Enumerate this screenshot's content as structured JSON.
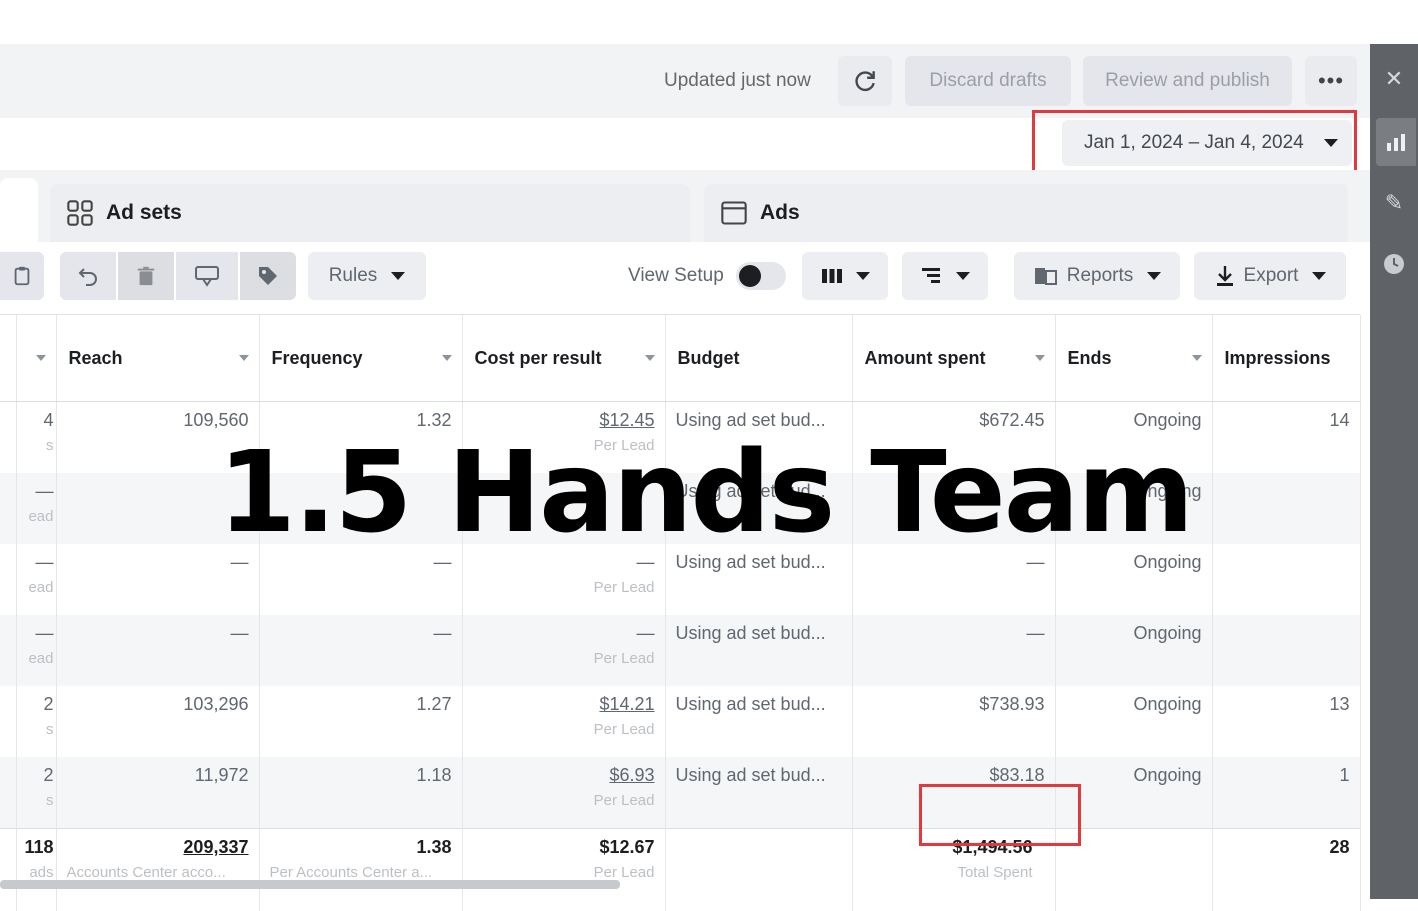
{
  "header": {
    "status": "Updated just now",
    "discard_label": "Discard drafts",
    "publish_label": "Review and publish",
    "more_label": "•••"
  },
  "date_range": "Jan 1, 2024 – Jan 4, 2024",
  "tabs": [
    {
      "label": "Ad sets",
      "icon": "grid-icon"
    },
    {
      "label": "Ads",
      "icon": "ad-frame-icon"
    }
  ],
  "toolbar": {
    "rules_label": "Rules",
    "view_setup_label": "View Setup",
    "reports_label": "Reports",
    "export_label": "Export"
  },
  "table": {
    "columns": [
      "Reach",
      "Frequency",
      "Cost per result",
      "Budget",
      "Amount spent",
      "Ends",
      "Impressions"
    ],
    "rows": [
      {
        "left": "4",
        "left_sub": "s",
        "reach": "109,560",
        "freq": "1.32",
        "cpr": "$12.45",
        "cpr_sub": "Per Lead",
        "budget": "Using ad set bud...",
        "spent": "$672.45",
        "ends": "Ongoing",
        "impr": "14"
      },
      {
        "left": "—",
        "left_sub": "ead",
        "reach": "",
        "freq": "",
        "cpr": "",
        "cpr_sub": "",
        "budget": "Using ad set bud...",
        "spent": "",
        "ends": "Ongoing",
        "impr": ""
      },
      {
        "left": "—",
        "left_sub": "ead",
        "reach": "—",
        "freq": "—",
        "cpr": "—",
        "cpr_sub": "Per Lead",
        "budget": "Using ad set bud...",
        "spent": "—",
        "ends": "Ongoing",
        "impr": ""
      },
      {
        "left": "—",
        "left_sub": "ead",
        "reach": "—",
        "freq": "—",
        "cpr": "—",
        "cpr_sub": "Per Lead",
        "budget": "Using ad set bud...",
        "spent": "—",
        "ends": "Ongoing",
        "impr": ""
      },
      {
        "left": "2",
        "left_sub": "s",
        "reach": "103,296",
        "freq": "1.27",
        "cpr": "$14.21",
        "cpr_sub": "Per Lead",
        "budget": "Using ad set bud...",
        "spent": "$738.93",
        "ends": "Ongoing",
        "impr": "13"
      },
      {
        "left": "2",
        "left_sub": "s",
        "reach": "11,972",
        "freq": "1.18",
        "cpr": "$6.93",
        "cpr_sub": "Per Lead",
        "budget": "Using ad set bud...",
        "spent": "$83.18",
        "ends": "Ongoing",
        "impr": "1"
      }
    ],
    "total": {
      "left": "118",
      "left_sub": "ads",
      "reach": "209,337",
      "reach_sub": "Accounts Center acco...",
      "freq": "1.38",
      "freq_sub": "Per Accounts Center a...",
      "cpr": "$12.67",
      "cpr_sub": "Per Lead",
      "spent": "$1,494.56",
      "spent_sub": "Total Spent",
      "impr": "28"
    }
  },
  "watermark": "1.5 Hands Team",
  "colors": {
    "highlight": "#e0393e",
    "sidebar": "#5f6368"
  }
}
